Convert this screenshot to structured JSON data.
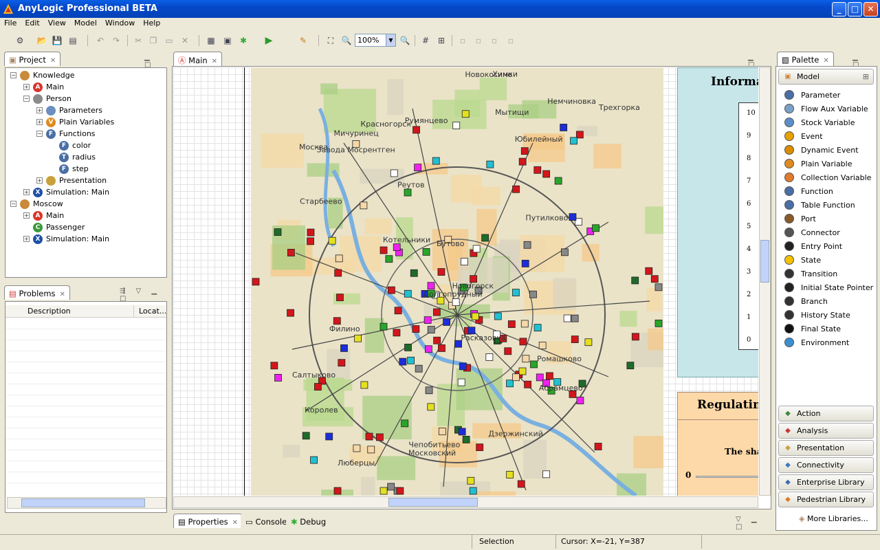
{
  "window": {
    "title": "AnyLogic Professional BETA",
    "minimize": "_",
    "maximize": "□",
    "close": "✕"
  },
  "menu": [
    "File",
    "Edit",
    "View",
    "Model",
    "Window",
    "Help"
  ],
  "toolbar": {
    "zoom": "100%"
  },
  "project_panel": {
    "tab": "Project",
    "tree": [
      {
        "label": "Knowledge",
        "level": 0,
        "icon": "model-icon",
        "expander": "−"
      },
      {
        "label": "Main",
        "level": 1,
        "icon": "agent-icon",
        "expander": "+"
      },
      {
        "label": "Person",
        "level": 1,
        "icon": "person-icon",
        "expander": "−"
      },
      {
        "label": "Parameters",
        "level": 2,
        "icon": "parameters-icon",
        "expander": "+"
      },
      {
        "label": "Plain Variables",
        "level": 2,
        "icon": "variable-icon",
        "expander": "+"
      },
      {
        "label": "Functions",
        "level": 2,
        "icon": "functions-icon",
        "expander": "−"
      },
      {
        "label": "color",
        "level": 3,
        "icon": "function-icon",
        "expander": ""
      },
      {
        "label": "radius",
        "level": 3,
        "icon": "table-function-icon",
        "expander": ""
      },
      {
        "label": "step",
        "level": 3,
        "icon": "function-icon",
        "expander": ""
      },
      {
        "label": "Presentation",
        "level": 2,
        "icon": "presentation-icon",
        "expander": "+"
      },
      {
        "label": "Simulation: Main",
        "level": 1,
        "icon": "simulation-icon",
        "expander": "+"
      },
      {
        "label": "Moscow",
        "level": 0,
        "icon": "model-icon",
        "expander": "−"
      },
      {
        "label": "Main",
        "level": 1,
        "icon": "agent-icon",
        "expander": "+"
      },
      {
        "label": "Passenger",
        "level": 1,
        "icon": "class-icon",
        "expander": ""
      },
      {
        "label": "Simulation: Main",
        "level": 1,
        "icon": "simulation-icon",
        "expander": "+"
      }
    ]
  },
  "problems_panel": {
    "tab": "Problems",
    "columns": [
      "Description",
      "Locat..."
    ]
  },
  "editor": {
    "tab": "Main",
    "map_labels": [
      "Долгопрудный",
      "Мытищи",
      "Юбилейный",
      "Королев",
      "Химки",
      "Филино",
      "Старбеево",
      "Чепобитьево",
      "Новогорск",
      "Путилково",
      "Красногорск",
      "Москва",
      "Реутов",
      "Новокосино",
      "Люберцы",
      "Котельники",
      "Дзержинский",
      "Мичуринец",
      "Трехгорка",
      "Немчиновка",
      "Румянцево",
      "Расказовка",
      "Московский",
      "Завода Мосрентген",
      "Бутово",
      "Абрамцево",
      "Ромашково",
      "Салтыково"
    ],
    "info_title": "Informa",
    "info_ticks": [
      "10",
      "9",
      "8",
      "7",
      "6",
      "5",
      "4",
      "3",
      "2",
      "1",
      "0"
    ],
    "reg_title": "Regulating",
    "reg_text": "The sha",
    "reg_slider_min": "0"
  },
  "palette": {
    "tab": "Palette",
    "section": "Model",
    "items": [
      {
        "label": "Parameter",
        "icon": "parameter-icon",
        "color": "#4a6fa5"
      },
      {
        "label": "Flow Aux Variable",
        "icon": "flow-aux-variable-icon",
        "color": "#7aa0c8"
      },
      {
        "label": "Stock Variable",
        "icon": "stock-variable-icon",
        "color": "#5b8fc9"
      },
      {
        "label": "Event",
        "icon": "event-icon",
        "color": "#e8a000"
      },
      {
        "label": "Dynamic Event",
        "icon": "dynamic-event-icon",
        "color": "#d98e00"
      },
      {
        "label": "Plain Variable",
        "icon": "plain-variable-icon",
        "color": "#e08a1e"
      },
      {
        "label": "Collection Variable",
        "icon": "collection-variable-icon",
        "color": "#e07a2e"
      },
      {
        "label": "Function",
        "icon": "function-icon",
        "color": "#4a6fa5"
      },
      {
        "label": "Table Function",
        "icon": "table-function-icon",
        "color": "#4a6fa5"
      },
      {
        "label": "Port",
        "icon": "port-icon",
        "color": "#8a5a2a"
      },
      {
        "label": "Connector",
        "icon": "connector-icon",
        "color": "#555555"
      },
      {
        "label": "Entry Point",
        "icon": "entry-point-icon",
        "color": "#222222"
      },
      {
        "label": "State",
        "icon": "state-icon",
        "color": "#f2c200"
      },
      {
        "label": "Transition",
        "icon": "transition-icon",
        "color": "#333333"
      },
      {
        "label": "Initial State Pointer",
        "icon": "initial-state-pointer-icon",
        "color": "#222222"
      },
      {
        "label": "Branch",
        "icon": "branch-icon",
        "color": "#333333"
      },
      {
        "label": "History State",
        "icon": "history-state-icon",
        "color": "#333333"
      },
      {
        "label": "Final State",
        "icon": "final-state-icon",
        "color": "#111111"
      },
      {
        "label": "Environment",
        "icon": "environment-icon",
        "color": "#3a8fd0"
      }
    ],
    "groups": [
      "Action",
      "Analysis",
      "Presentation",
      "Connectivity",
      "Enterprise Library",
      "Pedestrian Library"
    ],
    "more": "More Libraries..."
  },
  "bottom_tabs": [
    "Properties",
    "Console",
    "Debug"
  ],
  "status": {
    "mode": "Selection",
    "cursor": "Cursor:  X=-21, Y=387"
  }
}
